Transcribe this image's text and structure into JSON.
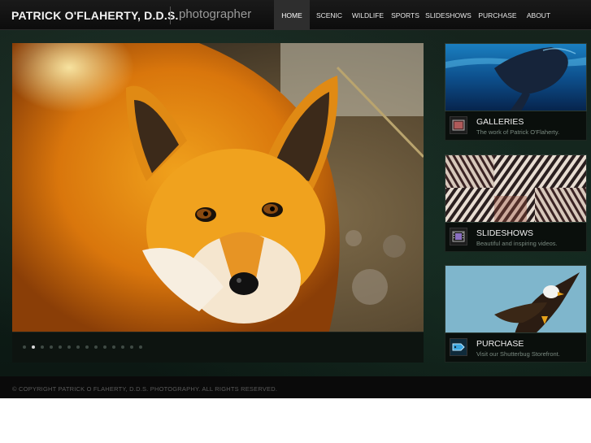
{
  "header": {
    "brand": "PATRICK O'FLAHERTY, D.D.S.",
    "tagline": "photographer"
  },
  "nav": [
    {
      "label": "HOME",
      "active": true
    },
    {
      "label": "SCENIC",
      "active": false
    },
    {
      "label": "WILDLIFE",
      "active": false
    },
    {
      "label": "SPORTS",
      "active": false
    },
    {
      "label": "SLIDESHOWS",
      "active": false
    },
    {
      "label": "PURCHASE",
      "active": false
    },
    {
      "label": "ABOUT",
      "active": false
    }
  ],
  "slideshow": {
    "slide_count": 14,
    "active_index": 1
  },
  "cards": [
    {
      "title": "GALLERIES",
      "subtitle": "The work of Patrick O'Flaherty."
    },
    {
      "title": "SLIDESHOWS",
      "subtitle": "Beautiful and inspiring videos."
    },
    {
      "title": "PURCHASE",
      "subtitle": "Visit our Shutterbug Storefront."
    }
  ],
  "footer": {
    "copyright": "© COPYRIGHT PATRICK O FLAHERTY, D.D.S. PHOTOGRAPHY. ALL RIGHTS RESERVED."
  },
  "colors": {
    "background": "#10201a",
    "header": "#111111",
    "nav_active": "#2e2e2e"
  }
}
